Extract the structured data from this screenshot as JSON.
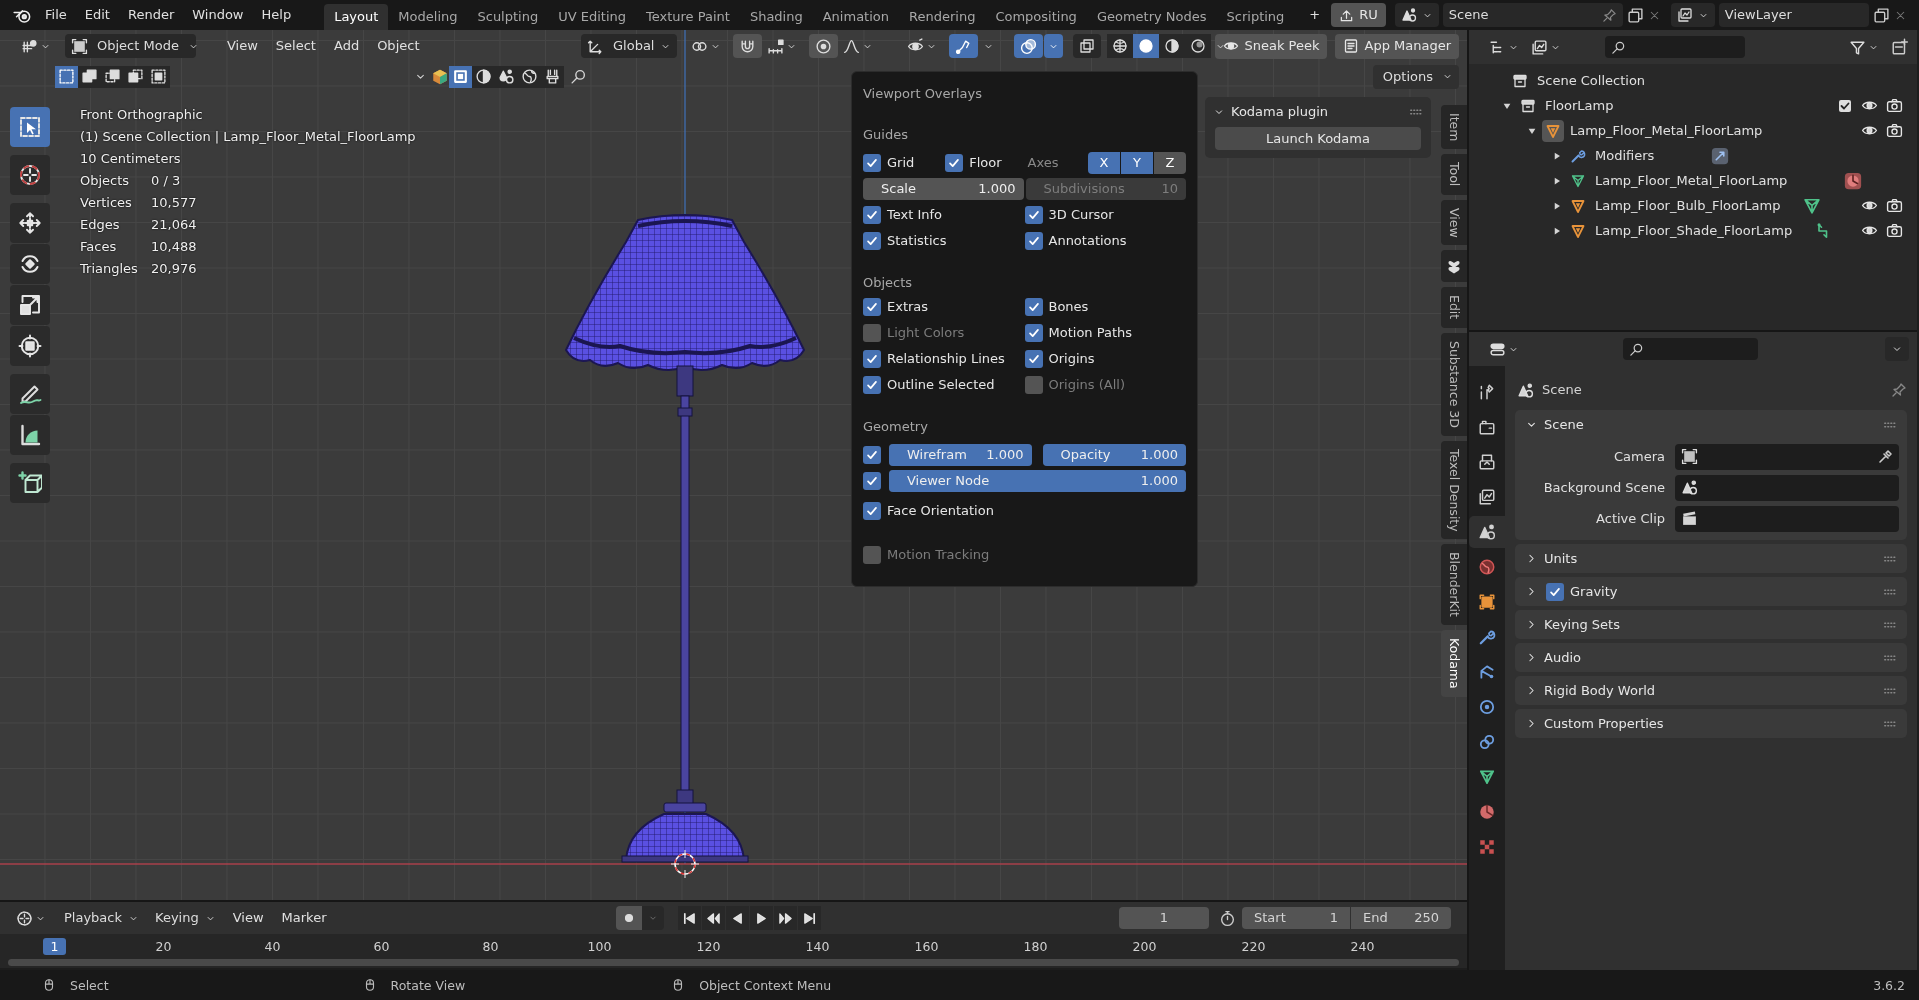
{
  "menu": [
    "File",
    "Edit",
    "Render",
    "Window",
    "Help"
  ],
  "workspaces": [
    {
      "label": "Layout",
      "selected": true
    },
    {
      "label": "Modeling",
      "selected": false
    },
    {
      "label": "Sculpting",
      "selected": false
    },
    {
      "label": "UV Editing",
      "selected": false
    },
    {
      "label": "Texture Paint",
      "selected": false
    },
    {
      "label": "Shading",
      "selected": false
    },
    {
      "label": "Animation",
      "selected": false
    },
    {
      "label": "Rendering",
      "selected": false
    },
    {
      "label": "Compositing",
      "selected": false
    },
    {
      "label": "Geometry Nodes",
      "selected": false
    },
    {
      "label": "Scripting",
      "selected": false
    }
  ],
  "add_workspace": "+",
  "language_button": "RU",
  "scene_selector": {
    "value": "Scene"
  },
  "view_layer_selector": {
    "value": "ViewLayer"
  },
  "viewport_header": {
    "mode": "Object Mode",
    "menus": [
      "View",
      "Select",
      "Add",
      "Object"
    ],
    "orientation": "Global",
    "addons": [
      "Sneak Peek",
      "App Manager"
    ],
    "options": "Options"
  },
  "viewport_info": {
    "lines": [
      "Front Orthographic",
      "(1) Scene Collection | Lamp_Floor_Metal_FloorLamp",
      "10 Centimeters"
    ],
    "stats": [
      {
        "label": "Objects",
        "value": "0 / 3"
      },
      {
        "label": "Vertices",
        "value": "10,577"
      },
      {
        "label": "Edges",
        "value": "21,064"
      },
      {
        "label": "Faces",
        "value": "10,488"
      },
      {
        "label": "Triangles",
        "value": "20,976"
      }
    ]
  },
  "tool_groups": [
    {
      "tools": [
        {
          "kind": "select_box",
          "selected": true
        }
      ]
    },
    {
      "tools": [
        {
          "kind": "cursor",
          "selected": false
        }
      ]
    },
    {
      "tools": [
        {
          "kind": "move",
          "selected": false
        },
        {
          "kind": "rotate",
          "selected": false
        },
        {
          "kind": "scale",
          "selected": false
        },
        {
          "kind": "transform",
          "selected": false
        }
      ]
    },
    {
      "tools": [
        {
          "kind": "annotate",
          "selected": false
        },
        {
          "kind": "measure",
          "selected": false
        }
      ]
    },
    {
      "tools": [
        {
          "kind": "add_cube",
          "selected": false
        }
      ]
    }
  ],
  "overlays": {
    "title": "Viewport Overlays",
    "guides": {
      "title": "Guides",
      "grid": {
        "label": "Grid",
        "checked": true
      },
      "floor": {
        "label": "Floor",
        "checked": true
      },
      "axes_label": "Axes",
      "axes": [
        {
          "label": "X",
          "on": true
        },
        {
          "label": "Y",
          "on": true
        },
        {
          "label": "Z",
          "on": false
        }
      ],
      "scale": {
        "label": "Scale",
        "value": "1.000"
      },
      "subdivisions": {
        "label": "Subdivisions",
        "value": "10",
        "disabled": true
      },
      "checks": [
        {
          "label": "Text Info",
          "checked": true
        },
        {
          "label": "3D Cursor",
          "checked": true
        },
        {
          "label": "Statistics",
          "checked": true
        },
        {
          "label": "Annotations",
          "checked": true
        }
      ]
    },
    "objects": {
      "title": "Objects",
      "checks": [
        {
          "label": "Extras",
          "checked": true
        },
        {
          "label": "Bones",
          "checked": true
        },
        {
          "label": "Light Colors",
          "checked": false
        },
        {
          "label": "Motion Paths",
          "checked": true
        },
        {
          "label": "Relationship Lines",
          "checked": true
        },
        {
          "label": "Origins",
          "checked": true
        },
        {
          "label": "Outline Selected",
          "checked": true
        },
        {
          "label": "Origins (All)",
          "checked": false
        }
      ]
    },
    "geometry": {
      "title": "Geometry",
      "wireframe": {
        "checked": true,
        "label": "Wirefram",
        "value": "1.000",
        "level": 1
      },
      "opacity": {
        "label": "Opacity",
        "value": "1.000",
        "level": 1
      },
      "viewer_node": {
        "checked": true,
        "label": "Viewer Node",
        "value": "1.000",
        "level": 1
      },
      "face_orientation": {
        "label": "Face Orientation",
        "checked": true
      }
    },
    "motion_tracking": {
      "label": "Motion Tracking",
      "checked": false
    }
  },
  "sidebar": {
    "tabs": [
      {
        "kind": "text",
        "label": "Item",
        "selected": false
      },
      {
        "kind": "text",
        "label": "Tool",
        "selected": false
      },
      {
        "kind": "text",
        "label": "View",
        "selected": false
      },
      {
        "kind": "icon",
        "selected": false
      },
      {
        "kind": "text",
        "label": "Edit",
        "selected": false
      },
      {
        "kind": "text",
        "label": "Substance 3D",
        "selected": false
      },
      {
        "kind": "text",
        "label": "Texel Density",
        "selected": false
      },
      {
        "kind": "text",
        "label": "BlenderKit",
        "selected": false
      },
      {
        "kind": "text",
        "label": "Kodama",
        "selected": true
      }
    ],
    "panel": {
      "title": "Kodama plugin",
      "expanded": true,
      "button": "Launch Kodama"
    }
  },
  "outliner": {
    "tree": [
      {
        "label": "Scene Collection",
        "kind": "scene_collection",
        "children": [
          {
            "label": "FloorLamp",
            "kind": "collection",
            "expanded": true,
            "checked": true,
            "children": [
              {
                "label": "Lamp_Floor_Metal_FloorLamp",
                "kind": "object",
                "expanded": true,
                "active": true,
                "children": [
                  {
                    "label": "Modifiers",
                    "kind": "modifiers",
                    "expanded": false,
                    "badge": {
                      "kind": "modifier"
                    }
                  },
                  {
                    "label": "Lamp_Floor_Metal_FloorLamp",
                    "kind": "mesh",
                    "expanded": false,
                    "badge": {
                      "kind": "material"
                    }
                  },
                  {
                    "label": "Lamp_Floor_Bulb_FloorLamp",
                    "kind": "object",
                    "expanded": false,
                    "badge": {
                      "kind": "mesh"
                    }
                  },
                  {
                    "label": "Lamp_Floor_Shade_FloorLamp",
                    "kind": "object",
                    "expanded": false,
                    "badge": {
                      "kind": "curve"
                    }
                  }
                ]
              }
            ]
          }
        ]
      }
    ]
  },
  "properties": {
    "tabs": [
      {
        "kind": "tool",
        "selected": false
      },
      {
        "kind": "render",
        "selected": false
      },
      {
        "kind": "output",
        "selected": false
      },
      {
        "kind": "view_layer",
        "selected": false
      },
      {
        "kind": "scene",
        "selected": true
      },
      {
        "kind": "world",
        "selected": false
      },
      {
        "kind": "object",
        "selected": false
      },
      {
        "kind": "modifiers",
        "selected": false
      },
      {
        "kind": "particles",
        "selected": false
      },
      {
        "kind": "physics",
        "selected": false
      },
      {
        "kind": "constraints",
        "selected": false
      },
      {
        "kind": "data",
        "selected": false
      },
      {
        "kind": "material",
        "selected": false
      },
      {
        "kind": "texture",
        "selected": false
      }
    ],
    "title": "Scene",
    "panels": [
      {
        "title": "Scene",
        "expanded": true,
        "fields": [
          {
            "label": "Camera",
            "kind": "camera"
          },
          {
            "label": "Background Scene",
            "kind": "scene"
          },
          {
            "label": "Active Clip",
            "kind": "clip"
          }
        ]
      },
      {
        "title": "Units",
        "expanded": false
      },
      {
        "title": "Gravity",
        "expanded": false,
        "checked": true
      },
      {
        "title": "Keying Sets",
        "expanded": false
      },
      {
        "title": "Audio",
        "expanded": false
      },
      {
        "title": "Rigid Body World",
        "expanded": false
      },
      {
        "title": "Custom Properties",
        "expanded": false
      }
    ]
  },
  "timeline": {
    "menus": [
      "Playback",
      "Keying",
      "View",
      "Marker"
    ],
    "current_frame": "1",
    "start": {
      "label": "Start",
      "value": "1"
    },
    "end": {
      "label": "End",
      "value": "250"
    },
    "ruler": [
      {
        "label": "1",
        "selected": true
      },
      {
        "label": "20",
        "selected": false
      },
      {
        "label": "40",
        "selected": false
      },
      {
        "label": "60",
        "selected": false
      },
      {
        "label": "80",
        "selected": false
      },
      {
        "label": "100",
        "selected": false
      },
      {
        "label": "120",
        "selected": false
      },
      {
        "label": "140",
        "selected": false
      },
      {
        "label": "160",
        "selected": false
      },
      {
        "label": "180",
        "selected": false
      },
      {
        "label": "200",
        "selected": false
      },
      {
        "label": "220",
        "selected": false
      },
      {
        "label": "240",
        "selected": false
      }
    ]
  },
  "status_bar": {
    "hints": [
      "Select",
      "Rotate View",
      "Object Context Menu"
    ],
    "version": "3.6.2"
  }
}
